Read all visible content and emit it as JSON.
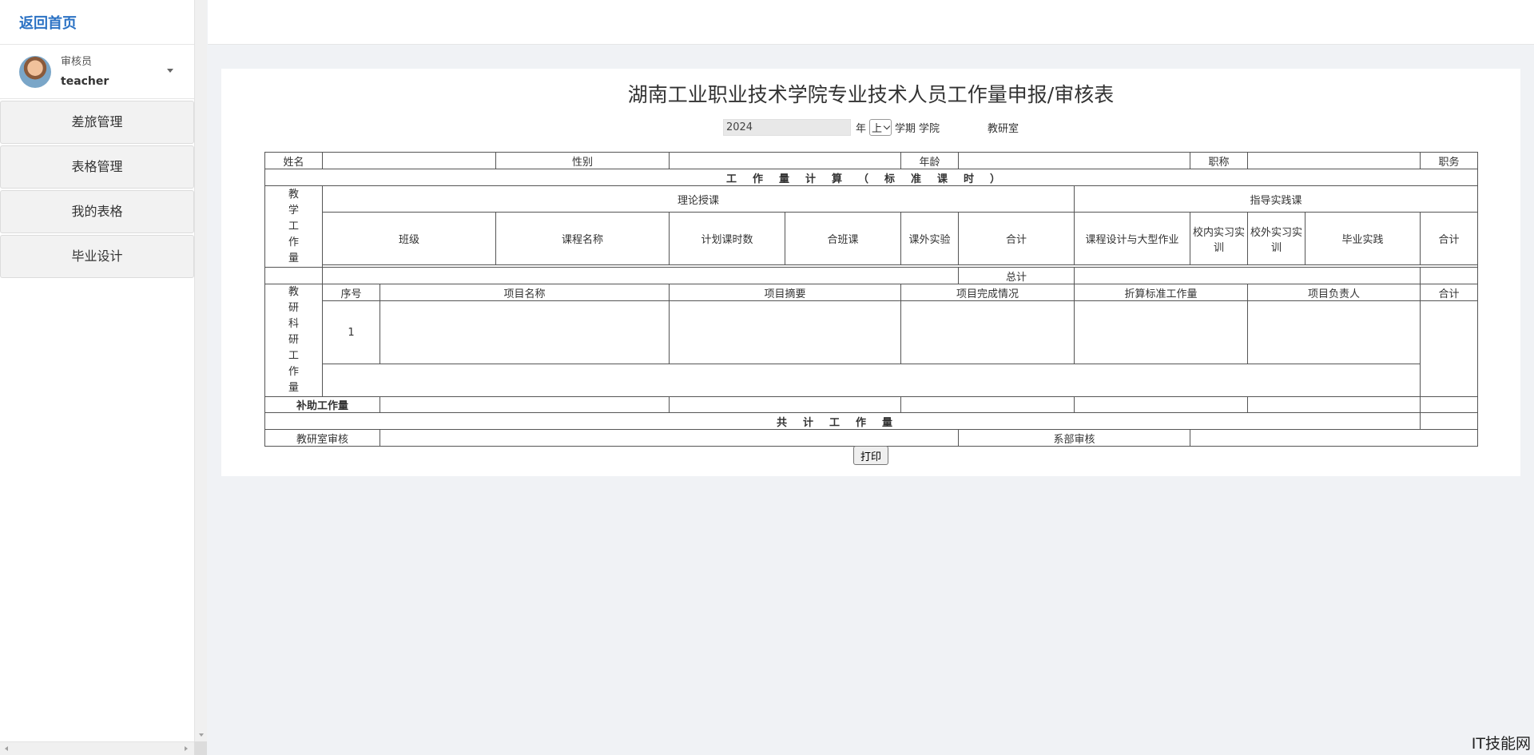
{
  "sidebar": {
    "home_link": "返回首页",
    "user": {
      "role": "审核员",
      "name": "teacher"
    },
    "items": [
      {
        "label": "差旅管理"
      },
      {
        "label": "表格管理"
      },
      {
        "label": "我的表格"
      },
      {
        "label": "毕业设计"
      }
    ]
  },
  "form": {
    "title": "湖南工业职业技术学院专业技术人员工作量申报/审核表",
    "year": "2024",
    "year_suffix": "年",
    "semester_selected": "上",
    "semester_suffix": "学期",
    "college_label": "学院",
    "office_label": "教研室",
    "row_info": {
      "name": "姓名",
      "gender": "性别",
      "age": "年龄",
      "title": "职称",
      "position": "职务"
    },
    "workload_calc": "工作量计算（标准课时）",
    "teaching_label": "教学工作量",
    "theory": "理论授课",
    "practice": "指导实践课",
    "theory_cols": [
      "班级",
      "课程名称",
      "计划课时数",
      "合班课",
      "课外实验",
      "合计"
    ],
    "practice_cols": [
      "课程设计与大型作业",
      "校内实习实训",
      "校外实习实训",
      "毕业实践",
      "合计"
    ],
    "total": "总计",
    "research_label": "教研科研工作量",
    "research_cols": [
      "序号",
      "项目名称",
      "项目摘要",
      "项目完成情况",
      "折算标准工作量",
      "项目负责人",
      "合计"
    ],
    "research_row_no": "1",
    "aux_label": "补助工作量",
    "grand_total": "共计工作量",
    "office_review": "教研室审核",
    "dept_review": "系部审核",
    "print_label": "打印"
  },
  "watermark": "IT技能网"
}
